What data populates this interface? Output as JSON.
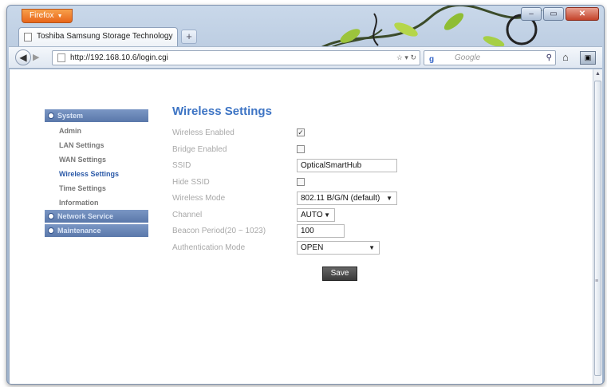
{
  "browser": {
    "app_button_label": "Firefox",
    "tab_title": "Toshiba Samsung Storage Technology",
    "new_tab_label": "+",
    "url": "http://192.168.10.6/login.cgi",
    "search_placeholder": "Google",
    "search_engine_glyph": "g",
    "window_controls": {
      "minimize": "–",
      "maximize": "▭",
      "close": "✕"
    }
  },
  "sidebar": {
    "sections": [
      {
        "label": "System",
        "items": [
          {
            "label": "Admin"
          },
          {
            "label": "LAN Settings"
          },
          {
            "label": "WAN Settings"
          },
          {
            "label": "Wireless Settings",
            "active": true
          },
          {
            "label": "Time Settings"
          },
          {
            "label": "Information"
          }
        ]
      },
      {
        "label": "Network Service"
      },
      {
        "label": "Maintenance"
      }
    ]
  },
  "form": {
    "title": "Wireless Settings",
    "wireless_enabled": {
      "label": "Wireless Enabled",
      "checked": true
    },
    "bridge_enabled": {
      "label": "Bridge Enabled",
      "checked": false
    },
    "ssid": {
      "label": "SSID",
      "value": "OpticalSmartHub"
    },
    "hide_ssid": {
      "label": "Hide SSID",
      "checked": false
    },
    "wireless_mode": {
      "label": "Wireless Mode",
      "value": "802.11 B/G/N (default)"
    },
    "channel": {
      "label": "Channel",
      "value": "AUTO"
    },
    "beacon_period": {
      "label": "Beacon Period(20 ~ 1023)",
      "value": "100"
    },
    "auth_mode": {
      "label": "Authentication Mode",
      "value": "OPEN"
    },
    "save_label": "Save"
  },
  "colors": {
    "title": "#3d74c4",
    "menu_header": "#5a78aa",
    "active_menu_item": "#2c5aa8",
    "app_button": "#e8661b"
  }
}
